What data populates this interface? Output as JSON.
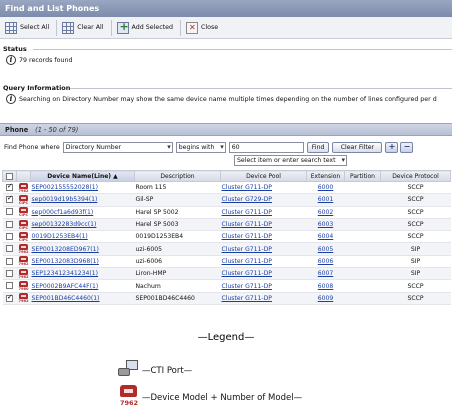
{
  "window": {
    "title": "Find and List Phones"
  },
  "toolbar": {
    "select_all": "Select All",
    "clear_all": "Clear All",
    "add_selected": "Add Selected",
    "close": "Close"
  },
  "status": {
    "heading": "Status",
    "message": "79 records found"
  },
  "query": {
    "heading": "Query Information",
    "message": "Searching on Directory Number may show the same device name multiple times depending on the number of lines configured per d"
  },
  "phone": {
    "heading": "Phone",
    "range": "(1 - 50 of 79)"
  },
  "find": {
    "label": "Find Phone where",
    "field": "Directory Number",
    "operator": "begins with",
    "value": "60",
    "find_button": "Find",
    "clear_filter_button": "Clear Filter",
    "add_icon": "+",
    "remove_icon": "−",
    "secondary": "Select item or enter search text"
  },
  "table": {
    "columns": [
      "",
      "",
      "Device Name(Line)",
      "Description",
      "Device Pool",
      "Extension",
      "Partition",
      "Device Protocol"
    ],
    "sort_indicator": "▲",
    "rows": [
      {
        "checked": true,
        "model": "7962",
        "device": "SEP002155552028(1)",
        "description": "Room 115",
        "pool": "Cluster G711-DP",
        "extension": "6000",
        "partition": "",
        "protocol": "SCCP"
      },
      {
        "checked": true,
        "model": "CIPC",
        "device": "sep0019d19b5394(1)",
        "description": "Gil-SP",
        "pool": "Cluster G729-DP",
        "extension": "6001",
        "partition": "",
        "protocol": "SCCP"
      },
      {
        "checked": false,
        "model": "CIPC",
        "device": "sep000cf1a6d93f(1)",
        "description": "Harel SP 5002",
        "pool": "Cluster G711-DP",
        "extension": "6002",
        "partition": "",
        "protocol": "SCCP"
      },
      {
        "checked": false,
        "model": "CIPC",
        "device": "sep00132283d9cc(1)",
        "description": "Harel SP 5003",
        "pool": "Cluster G711-DP",
        "extension": "6003",
        "partition": "",
        "protocol": "SCCP"
      },
      {
        "checked": false,
        "model": "CIPC",
        "device": "0019D1253EB4(1)",
        "description": "0019D1253EB4",
        "pool": "Cluster G711-DP",
        "extension": "6004",
        "partition": "",
        "protocol": "SCCP"
      },
      {
        "checked": false,
        "model": "7962",
        "device": "SEP0013208ED967(1)",
        "description": "uzi-6005",
        "pool": "Cluster G711-DP",
        "extension": "6005",
        "partition": "",
        "protocol": "SIP"
      },
      {
        "checked": false,
        "model": "7962",
        "device": "SEP00132083D968(1)",
        "description": "uzi-6006",
        "pool": "Cluster G711-DP",
        "extension": "6006",
        "partition": "",
        "protocol": "SIP"
      },
      {
        "checked": false,
        "model": "7962",
        "device": "SEP123412341234(1)",
        "description": "Liron-HMP",
        "pool": "Cluster G711-DP",
        "extension": "6007",
        "partition": "",
        "protocol": "SIP"
      },
      {
        "checked": false,
        "model": "7960",
        "device": "SEP0002B9AFC44F(1)",
        "description": "Nachum",
        "pool": "Cluster G711-DP",
        "extension": "6008",
        "partition": "",
        "protocol": "SCCP"
      },
      {
        "checked": true,
        "model": "7962",
        "device": "SEP001BD46C4460(1)",
        "description": "SEP001BD46C4460",
        "pool": "Cluster G711-DP",
        "extension": "6009",
        "partition": "",
        "protocol": "SCCP"
      }
    ]
  },
  "legend": {
    "title": "—Legend—",
    "cti_label": "—CTI Port—",
    "model_label": "—Device Model + Number of Model—",
    "model_example": "7962"
  },
  "colors": {
    "titlebar": "#8896b4",
    "link": "#1a3ea8",
    "phone_red": "#b22b2b"
  }
}
